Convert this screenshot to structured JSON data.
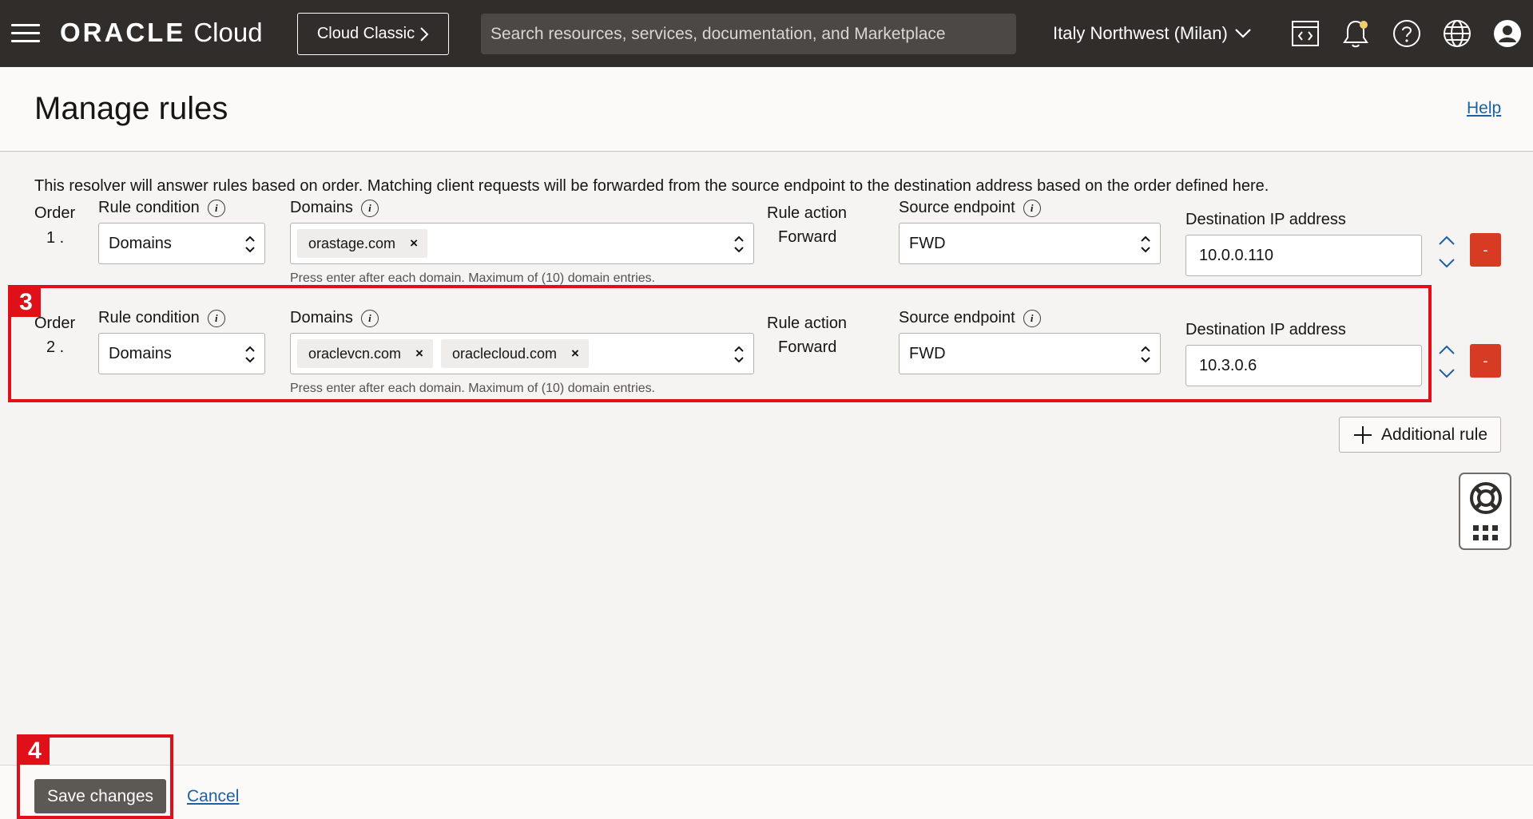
{
  "topbar": {
    "brand_oracle": "ORACLE",
    "brand_cloud": "Cloud",
    "classic_label": "Cloud Classic",
    "search_placeholder": "Search resources, services, documentation, and Marketplace",
    "region": "Italy Northwest (Milan)"
  },
  "header": {
    "title": "Manage rules",
    "help": "Help"
  },
  "intro": "This resolver will answer rules based on order. Matching client requests will be forwarded from the source endpoint to the destination address based on the order defined here.",
  "labels": {
    "order": "Order",
    "rule_condition": "Rule condition",
    "domains": "Domains",
    "rule_action": "Rule action",
    "source_endpoint": "Source endpoint",
    "destination_ip": "Destination IP address",
    "domains_helper": "Press enter after each domain. Maximum of (10) domain entries.",
    "remove": "-"
  },
  "rules": [
    {
      "order": "1 .",
      "condition": "Domains",
      "domains": [
        "orastage.com"
      ],
      "action": "Forward",
      "source": "FWD",
      "destination": "10.0.0.110"
    },
    {
      "order": "2 .",
      "condition": "Domains",
      "domains": [
        "oraclevcn.com",
        "oraclecloud.com"
      ],
      "action": "Forward",
      "source": "FWD",
      "destination": "10.3.0.6"
    }
  ],
  "additional_rule": "Additional rule",
  "footer": {
    "save": "Save changes",
    "cancel": "Cancel"
  },
  "annotations": {
    "badge_rules": "3",
    "badge_save": "4"
  },
  "colors": {
    "topbar": "#312d2a",
    "danger": "#d73b24",
    "highlight": "#e0101a",
    "link": "#1b61a3"
  }
}
